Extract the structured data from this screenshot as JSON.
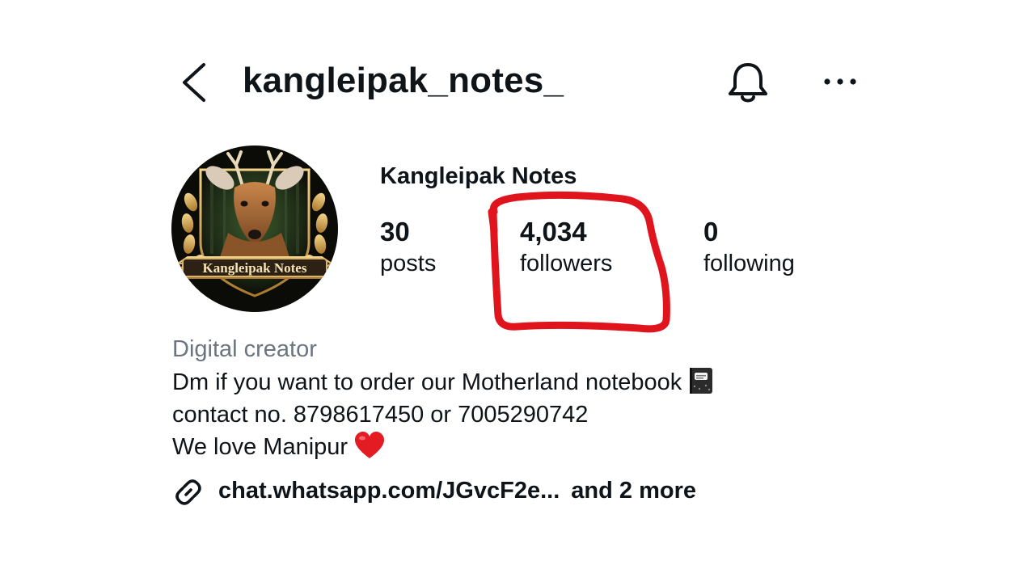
{
  "header": {
    "username": "kangleipak_notes_",
    "back_icon": "chevron-left-icon",
    "bell_icon": "bell-icon",
    "more_icon": "more-horizontal-icon"
  },
  "profile": {
    "display_name": "Kangleipak Notes",
    "avatar_text": "Kangleipak Notes",
    "category": "Digital creator"
  },
  "stats": {
    "posts": {
      "value": "30",
      "label": "posts"
    },
    "followers": {
      "value": "4,034",
      "label": "followers"
    },
    "following": {
      "value": "0",
      "label": "following"
    }
  },
  "bio": {
    "line1": "Dm if you want to order our Motherland notebook",
    "line2": "contact no. 8798617450 or 7005290742",
    "line3": "We love Manipur"
  },
  "link": {
    "url": "chat.whatsapp.com/JGvcF2e...",
    "more": "and 2 more",
    "icon": "link-icon"
  },
  "colors": {
    "annotation": "#e0141c",
    "text": "#0f1419",
    "muted": "#6b7580"
  }
}
